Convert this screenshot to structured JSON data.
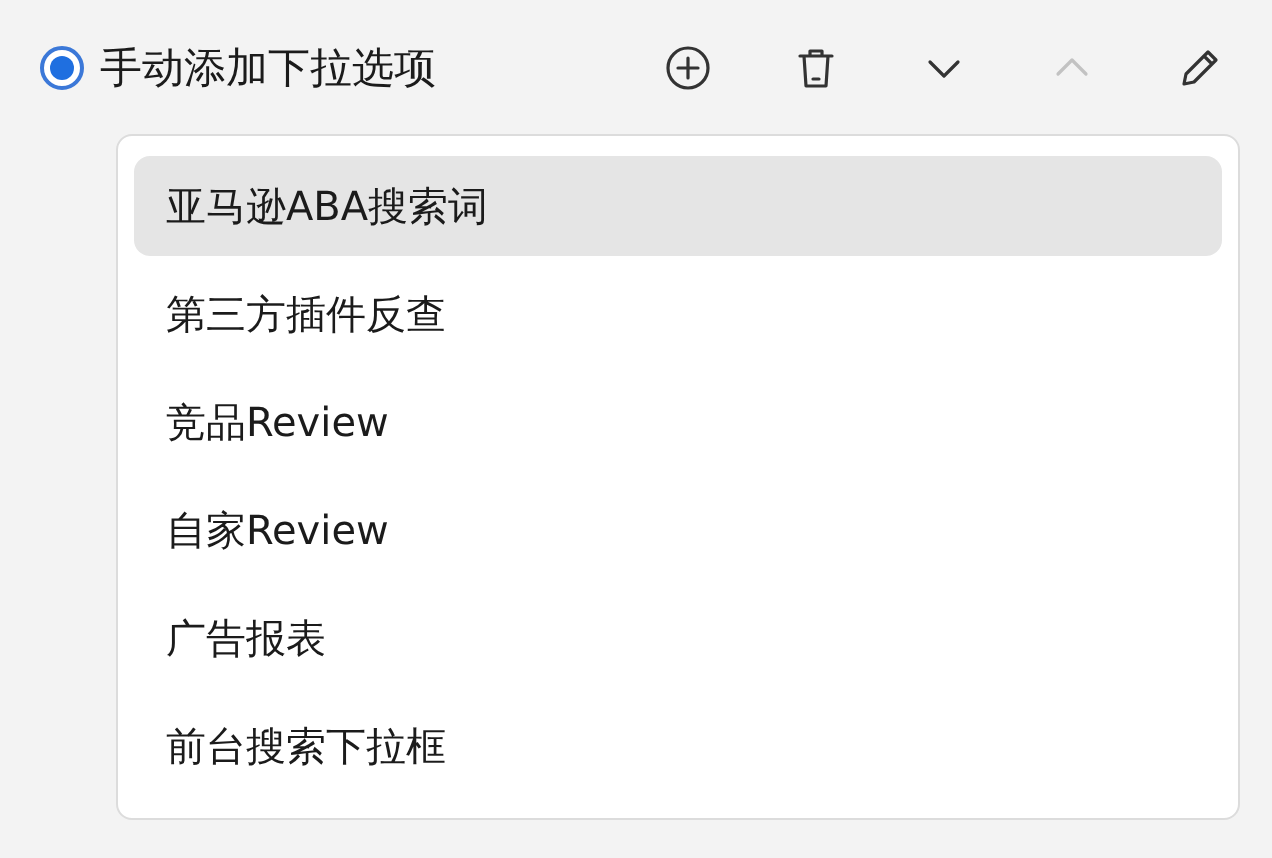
{
  "radio": {
    "label": "手动添加下拉选项",
    "selected": true
  },
  "toolbar": [
    {
      "kind": "add",
      "disabled": false
    },
    {
      "kind": "delete",
      "disabled": false
    },
    {
      "kind": "move-down",
      "disabled": false
    },
    {
      "kind": "move-up",
      "disabled": true
    },
    {
      "kind": "edit",
      "disabled": false
    }
  ],
  "options": [
    {
      "label": "亚马逊ABA搜索词",
      "selected": true
    },
    {
      "label": "第三方插件反查",
      "selected": false
    },
    {
      "label": "竞品Review",
      "selected": false
    },
    {
      "label": "自家Review",
      "selected": false
    },
    {
      "label": "广告报表",
      "selected": false
    },
    {
      "label": "前台搜索下拉框",
      "selected": false
    }
  ]
}
